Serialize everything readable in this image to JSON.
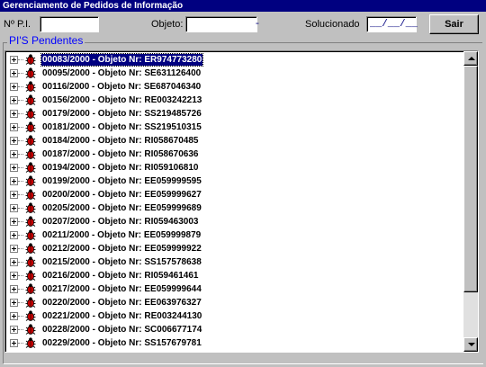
{
  "window": {
    "title": "Gerenciamento de Pedidos de Informação"
  },
  "filters": {
    "pi_label": "Nº P.I.",
    "pi_value": "",
    "objeto_label": "Objeto:",
    "objeto_value": "           -",
    "solucionado_label": "Solucionado",
    "solucionado_value": "__/__/__"
  },
  "toolbar": {
    "sair_label": "Sair"
  },
  "group": {
    "title": "PI'S Pendentes"
  },
  "tree": {
    "items": [
      {
        "label": "00083/2000 - Objeto Nr: ER974773280",
        "selected": true
      },
      {
        "label": "00095/2000 - Objeto Nr: SE631126400"
      },
      {
        "label": "00116/2000 - Objeto Nr: SE687046340"
      },
      {
        "label": "00156/2000 - Objeto Nr: RE003242213"
      },
      {
        "label": "00179/2000 - Objeto Nr: SS219485726"
      },
      {
        "label": "00181/2000 - Objeto Nr: SS219510315"
      },
      {
        "label": "00184/2000 - Objeto Nr: RI058670485"
      },
      {
        "label": "00187/2000 - Objeto Nr: RI058670636"
      },
      {
        "label": "00194/2000 - Objeto Nr: RI059106810"
      },
      {
        "label": "00199/2000 - Objeto Nr: EE059999595"
      },
      {
        "label": "00200/2000 - Objeto Nr: EE059999627"
      },
      {
        "label": "00205/2000 - Objeto Nr: EE059999689"
      },
      {
        "label": "00207/2000 - Objeto Nr: RI059463003"
      },
      {
        "label": "00211/2000 - Objeto Nr: EE059999879"
      },
      {
        "label": "00212/2000 - Objeto Nr: EE059999922"
      },
      {
        "label": "00215/2000 - Objeto Nr: SS157578638"
      },
      {
        "label": "00216/2000 - Objeto Nr: RI059461461"
      },
      {
        "label": "00217/2000 - Objeto Nr: EE059999644"
      },
      {
        "label": "00220/2000 - Objeto Nr: EE063976327"
      },
      {
        "label": "00221/2000 - Objeto Nr: RE003244130"
      },
      {
        "label": "00228/2000 - Objeto Nr: SC006677174"
      },
      {
        "label": "00229/2000 - Objeto Nr: SS157679781"
      }
    ]
  },
  "colors": {
    "title_bar": "#000080",
    "group_title": "#0000ff",
    "selection": "#000080",
    "bug_icon": "#cc0000"
  },
  "icons": {
    "expander": "plus-box-icon",
    "item": "bug-icon"
  }
}
